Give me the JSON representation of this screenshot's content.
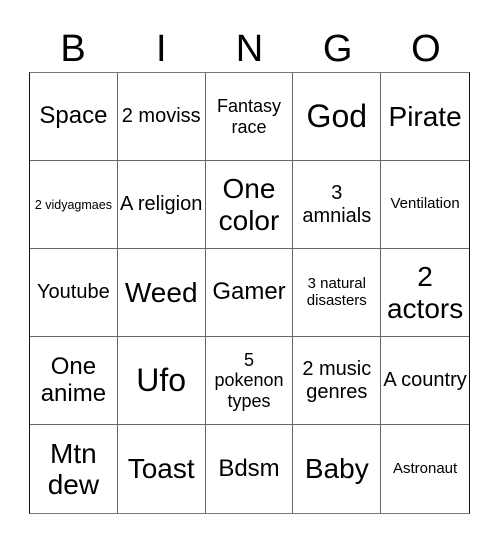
{
  "header": {
    "letters": [
      "B",
      "I",
      "N",
      "G",
      "O"
    ]
  },
  "cells": [
    {
      "text": "Space",
      "size": "s-ml"
    },
    {
      "text": "2 moviss",
      "size": "s-md"
    },
    {
      "text": "Fantasy race",
      "size": "s-sm"
    },
    {
      "text": "God",
      "size": "s-xl"
    },
    {
      "text": "Pirate",
      "size": "s-lg"
    },
    {
      "text": "2 vidyagmaes",
      "size": "s-xxs"
    },
    {
      "text": "A religion",
      "size": "s-md"
    },
    {
      "text": "One color",
      "size": "s-lg"
    },
    {
      "text": "3 amnials",
      "size": "s-md"
    },
    {
      "text": "Ventilation",
      "size": "s-xs"
    },
    {
      "text": "Youtube",
      "size": "s-md"
    },
    {
      "text": "Weed",
      "size": "s-lg"
    },
    {
      "text": "Gamer",
      "size": "s-ml"
    },
    {
      "text": "3 natural disasters",
      "size": "s-xs"
    },
    {
      "text": "2 actors",
      "size": "s-lg"
    },
    {
      "text": "One anime",
      "size": "s-ml"
    },
    {
      "text": "Ufo",
      "size": "s-xl"
    },
    {
      "text": "5 pokenon types",
      "size": "s-sm"
    },
    {
      "text": "2 music genres",
      "size": "s-md"
    },
    {
      "text": "A country",
      "size": "s-md"
    },
    {
      "text": "Mtn dew",
      "size": "s-lg"
    },
    {
      "text": "Toast",
      "size": "s-lg"
    },
    {
      "text": "Bdsm",
      "size": "s-ml"
    },
    {
      "text": "Baby",
      "size": "s-lg"
    },
    {
      "text": "Astronaut",
      "size": "s-xs"
    }
  ]
}
